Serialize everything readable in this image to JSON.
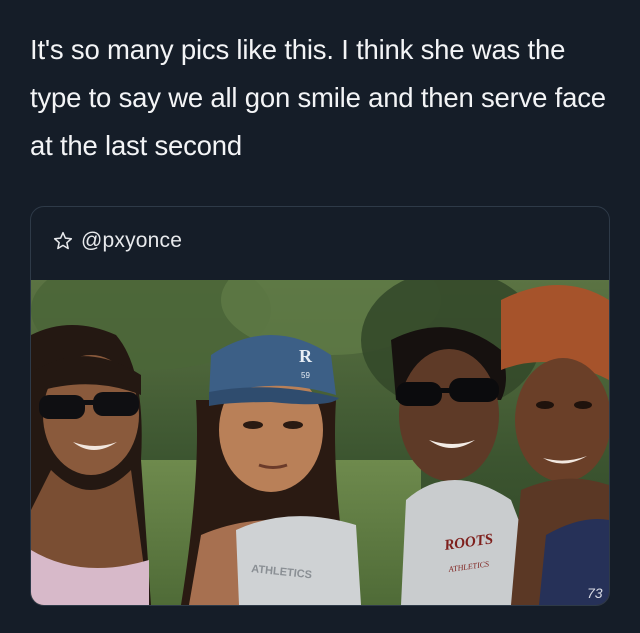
{
  "tweet": {
    "text": "It's so many pics like this. I think she was the type to say we all gon smile and then serve face at the last second"
  },
  "quoted": {
    "icon": "star-outline-icon",
    "handle": "@pxyonce"
  },
  "photo": {
    "cap_logo": "R",
    "cap_number": "59",
    "shirt_text_center": "ATHLETICS",
    "shirt_text_right_top": "ROOTS",
    "shirt_text_right_bottom": "ATHLETICS",
    "shirt_text_far_right": "73",
    "colors": {
      "background": "#151d28",
      "card_border": "#2e3a48",
      "foliage": "#3e5a2e",
      "cap": "#3c5f86"
    }
  }
}
